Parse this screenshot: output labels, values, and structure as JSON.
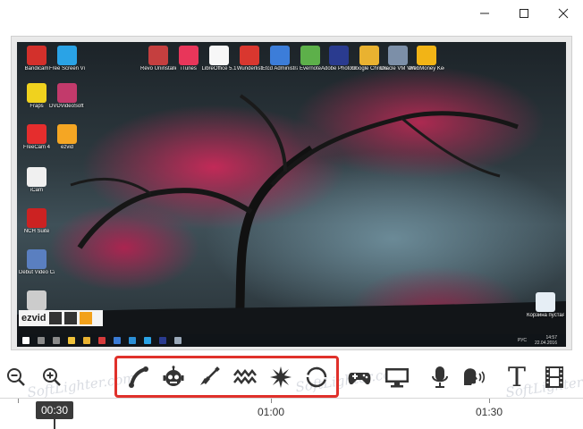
{
  "window": {
    "minimize_label": "Minimize",
    "maximize_label": "Maximize",
    "close_label": "Close"
  },
  "desktop": {
    "left_icons": [
      {
        "label": "Bandicam",
        "color": "#d3302b"
      },
      {
        "label": "Free Screen Video Re...",
        "color": "#2aa3e6"
      },
      {
        "label": "Fraps",
        "color": "#f0d21e"
      },
      {
        "label": "DVDVideoSoft Free Studio",
        "color": "#c23a6b"
      },
      {
        "label": "FreeCam 4",
        "color": "#e52d2d"
      },
      {
        "label": "ezvid",
        "color": "#f5a623"
      },
      {
        "label": "iCam",
        "color": "#f0f0f0"
      },
      {
        "label": "NCH Suite",
        "color": "#cc2222"
      },
      {
        "label": "Debut Video Capture S...",
        "color": "#5a7fc0"
      },
      {
        "label": "",
        "color": "#cccccc"
      }
    ],
    "top_icons": [
      {
        "label": "Revo Uninstaller",
        "color": "#c53f3f"
      },
      {
        "label": "iTunes",
        "color": "#e8365a"
      },
      {
        "label": "LibreOffice 5.1",
        "color": "#f7f7f7"
      },
      {
        "label": "Wunderlist",
        "color": "#d9372f"
      },
      {
        "label": "Etcd Administrator",
        "color": "#3c7dd9"
      },
      {
        "label": "Evernote",
        "color": "#5db04a"
      },
      {
        "label": "Adobe Photoshop",
        "color": "#2a3b8f"
      },
      {
        "label": "Google Chrome",
        "color": "#e9b230"
      },
      {
        "label": "Oracle VM VirtualBox",
        "color": "#7c8fa8"
      },
      {
        "label": "WebMoney Keeper",
        "color": "#f2b416"
      }
    ],
    "recycle_bin_label": "Корзина пустая",
    "logo_text": "ezvid",
    "taskbar": {
      "language": "РУС",
      "time": "14:57",
      "date": "22.04.2016"
    }
  },
  "toolbar": {
    "tools": [
      {
        "name": "zoom-out",
        "label": "Zoom out"
      },
      {
        "name": "zoom-in",
        "label": "Zoom in"
      },
      {
        "name": "phone",
        "label": "Phone"
      },
      {
        "name": "robot",
        "label": "Robot"
      },
      {
        "name": "guitar",
        "label": "Guitar"
      },
      {
        "name": "waves",
        "label": "Waves"
      },
      {
        "name": "burst",
        "label": "Burst"
      },
      {
        "name": "swirl",
        "label": "Swirl"
      },
      {
        "name": "gamepad",
        "label": "Game"
      },
      {
        "name": "monitor",
        "label": "Screen capture"
      },
      {
        "name": "microphone",
        "label": "Record voice"
      },
      {
        "name": "speech",
        "label": "Speech"
      },
      {
        "name": "text",
        "label": "Text"
      },
      {
        "name": "film",
        "label": "Video"
      }
    ],
    "text_glyph": "T",
    "highlight_color": "#e0312b"
  },
  "watermarks": [
    "SoftLighter.com",
    "SoftLighter.com",
    "SoftLighter.com"
  ],
  "timeline": {
    "playhead_time": "00:30",
    "ticks": [
      "01:00",
      "01:30"
    ]
  }
}
